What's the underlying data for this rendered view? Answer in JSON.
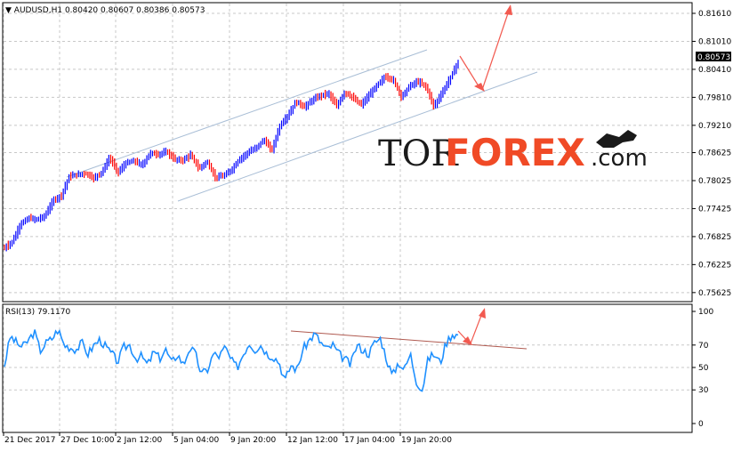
{
  "chart_data": [
    {
      "type": "candlestick",
      "symbol": "AUDUSD,H1",
      "ohlc": {
        "open": "0.80420",
        "high": "0.80607",
        "low": "0.80386",
        "close": "0.80573"
      },
      "current_price_label": "0.80573",
      "ylim": [
        0.7545,
        0.8182
      ],
      "y_ticks": [
        "0.81610",
        "0.81010",
        "0.80410",
        "0.79810",
        "0.79210",
        "0.78625",
        "0.78025",
        "0.77425",
        "0.76825",
        "0.76225",
        "0.75625"
      ],
      "x_ticks": [
        "21 Dec 2017",
        "27 Dec 10:00",
        "2 Jan 12:00",
        "5 Jan 04:00",
        "9 Jan 20:00",
        "12 Jan 12:00",
        "17 Jan 04:00",
        "19 Jan 20:00"
      ],
      "bull_color": "#0000ff",
      "bear_color": "#ff0000",
      "channel_color": "#a9bed6",
      "arrow_color": "#f25a50",
      "series": [
        {
          "values": [
            0.7658,
            0.7672,
            0.771,
            0.7722,
            0.7719,
            0.7727,
            0.776,
            0.777,
            0.7812,
            0.7815,
            0.7818,
            0.7808,
            0.782,
            0.7852,
            0.782,
            0.784,
            0.7845,
            0.7835,
            0.7862,
            0.7858,
            0.7865,
            0.7848,
            0.7846,
            0.7858,
            0.7828,
            0.7843,
            0.781,
            0.7812,
            0.7825,
            0.7848,
            0.7862,
            0.7872,
            0.789,
            0.7868,
            0.792,
            0.7942,
            0.7972,
            0.796,
            0.7975,
            0.7985,
            0.799,
            0.7962,
            0.7992,
            0.798,
            0.7965,
            0.7985,
            0.8008,
            0.8025,
            0.8018,
            0.7982,
            0.8005,
            0.8015,
            0.8005,
            0.7962,
            0.799,
            0.8022,
            0.8057
          ]
        }
      ]
    },
    {
      "type": "line",
      "title": "RSI(13) 79.1170",
      "ylim": [
        0,
        100
      ],
      "y_ticks": [
        "100",
        "70",
        "50",
        "30",
        "0"
      ],
      "line_color": "#1e90ff",
      "trend_color": "#b05a50",
      "series": [
        {
          "values": [
            52,
            78,
            72,
            68,
            74,
            82,
            65,
            72,
            76,
            84,
            70,
            68,
            66,
            72,
            62,
            70,
            75,
            68,
            62,
            55,
            68,
            70,
            58,
            60,
            52,
            64,
            58,
            66,
            54,
            62,
            52,
            68,
            62,
            44,
            48,
            62,
            60,
            68,
            56,
            50,
            62,
            72,
            66,
            70,
            62,
            60,
            55,
            38,
            52,
            48,
            66,
            74,
            80,
            72,
            66,
            70,
            62,
            58,
            52,
            70,
            66,
            62,
            72,
            76,
            58,
            42,
            55,
            48,
            62,
            38,
            30,
            58,
            62,
            54,
            72,
            80,
            79
          ]
        }
      ]
    }
  ]
}
